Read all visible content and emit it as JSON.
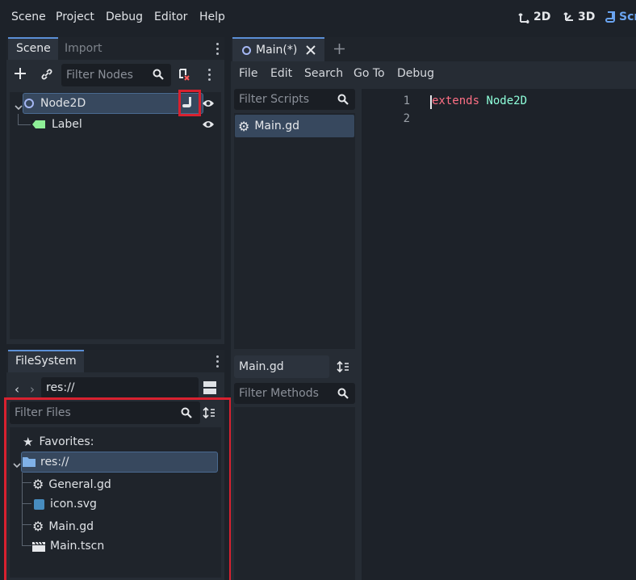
{
  "menubar": {
    "items": [
      "Scene",
      "Project",
      "Debug",
      "Editor",
      "Help"
    ],
    "modes": [
      "2D",
      "3D",
      "Scr"
    ]
  },
  "scene_dock": {
    "tabs": [
      "Scene",
      "Import"
    ],
    "filter_placeholder": "Filter Nodes",
    "nodes": [
      {
        "name": "Node2D"
      },
      {
        "name": "Label"
      }
    ]
  },
  "filesystem_dock": {
    "tab": "FileSystem",
    "path": "res://",
    "filter_placeholder": "Filter Files",
    "favorites_label": "Favorites:",
    "root_label": "res://",
    "files": [
      "General.gd",
      "icon.svg",
      "Main.gd",
      "Main.tscn"
    ]
  },
  "editor": {
    "tab_label": "Main(*)",
    "menu": [
      "File",
      "Edit",
      "Search",
      "Go To",
      "Debug"
    ],
    "filter_scripts_placeholder": "Filter Scripts",
    "script_list": [
      "Main.gd"
    ],
    "current_script_name": "Main.gd",
    "filter_methods_placeholder": "Filter Methods",
    "lines": [
      {
        "number": "1",
        "keyword": "extends",
        "type": "Node2D"
      },
      {
        "number": "2",
        "keyword": "",
        "type": ""
      }
    ]
  },
  "colors": {
    "accent": "#5b8fd6",
    "highlight_box": "#d8212f",
    "keyword": "#ff7085",
    "type": "#8effda"
  }
}
